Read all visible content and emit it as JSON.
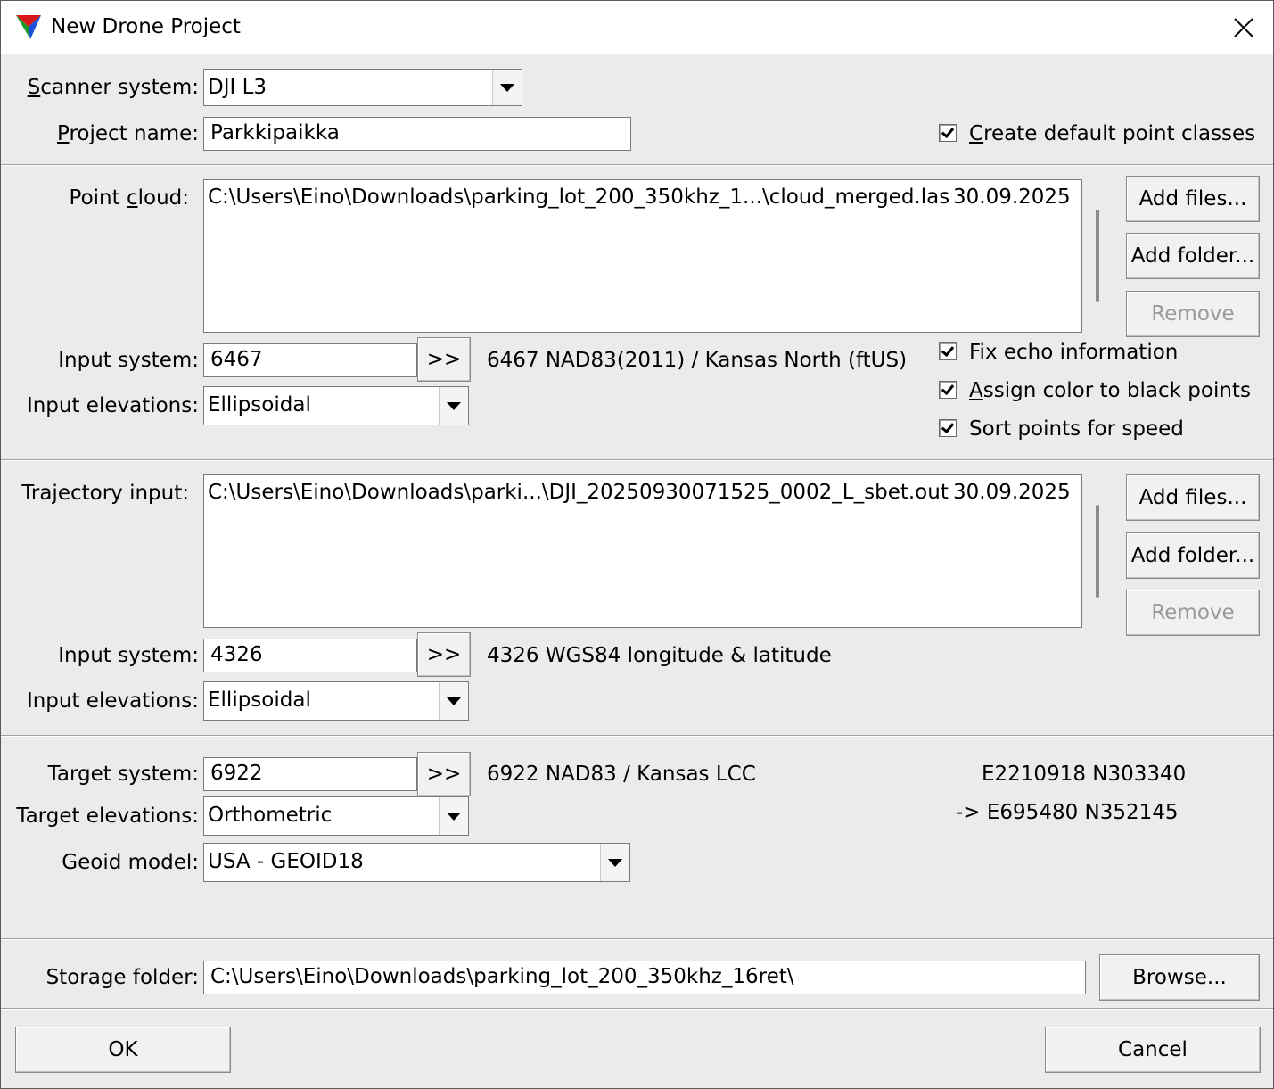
{
  "window": {
    "title": "New Drone Project"
  },
  "scanner": {
    "label": "Scanner system:",
    "value": "DJI L3"
  },
  "project": {
    "label": "Project name:",
    "value": "Parkkipaikka"
  },
  "create_default": {
    "label": "Create default point classes",
    "checked": true
  },
  "point_cloud": {
    "label": "Point cloud:",
    "files": [
      {
        "path": "C:\\Users\\Eino\\Downloads\\parking_lot_200_350khz_1...\\cloud_merged.las",
        "date": "30.09.2025"
      }
    ],
    "add_files": "Add files...",
    "add_folder": "Add folder...",
    "remove": "Remove",
    "input_system_label": "Input system:",
    "input_system": "6467",
    "pick": ">>",
    "input_system_desc": "6467 NAD83(2011) / Kansas North (ftUS)",
    "input_elev_label": "Input elevations:",
    "input_elev": "Ellipsoidal",
    "fix_echo": {
      "label": "Fix echo information",
      "checked": true
    },
    "assign_color": {
      "label": "Assign color to black points",
      "checked": true
    },
    "sort_points": {
      "label": "Sort points for speed",
      "checked": true
    }
  },
  "trajectory": {
    "label": "Trajectory input:",
    "files": [
      {
        "path": "C:\\Users\\Eino\\Downloads\\parki...\\DJI_20250930071525_0002_L_sbet.out",
        "date": "30.09.2025"
      }
    ],
    "add_files": "Add files...",
    "add_folder": "Add folder...",
    "remove": "Remove",
    "input_system_label": "Input system:",
    "input_system": "4326",
    "pick": ">>",
    "input_system_desc": "4326 WGS84 longitude & latitude",
    "input_elev_label": "Input elevations:",
    "input_elev": "Ellipsoidal"
  },
  "target": {
    "system_label": "Target system:",
    "system": "6922",
    "pick": ">>",
    "system_desc": "6922 NAD83 / Kansas LCC",
    "coord_line1": "E2210918 N303340",
    "coord_line2": "-> E695480 N352145",
    "elev_label": "Target elevations:",
    "elev": "Orthometric",
    "geoid_label": "Geoid model:",
    "geoid": "USA - GEOID18"
  },
  "storage": {
    "label": "Storage folder:",
    "value": "C:\\Users\\Eino\\Downloads\\parking_lot_200_350khz_16ret\\",
    "browse": "Browse..."
  },
  "footer": {
    "ok": "OK",
    "cancel": "Cancel"
  }
}
